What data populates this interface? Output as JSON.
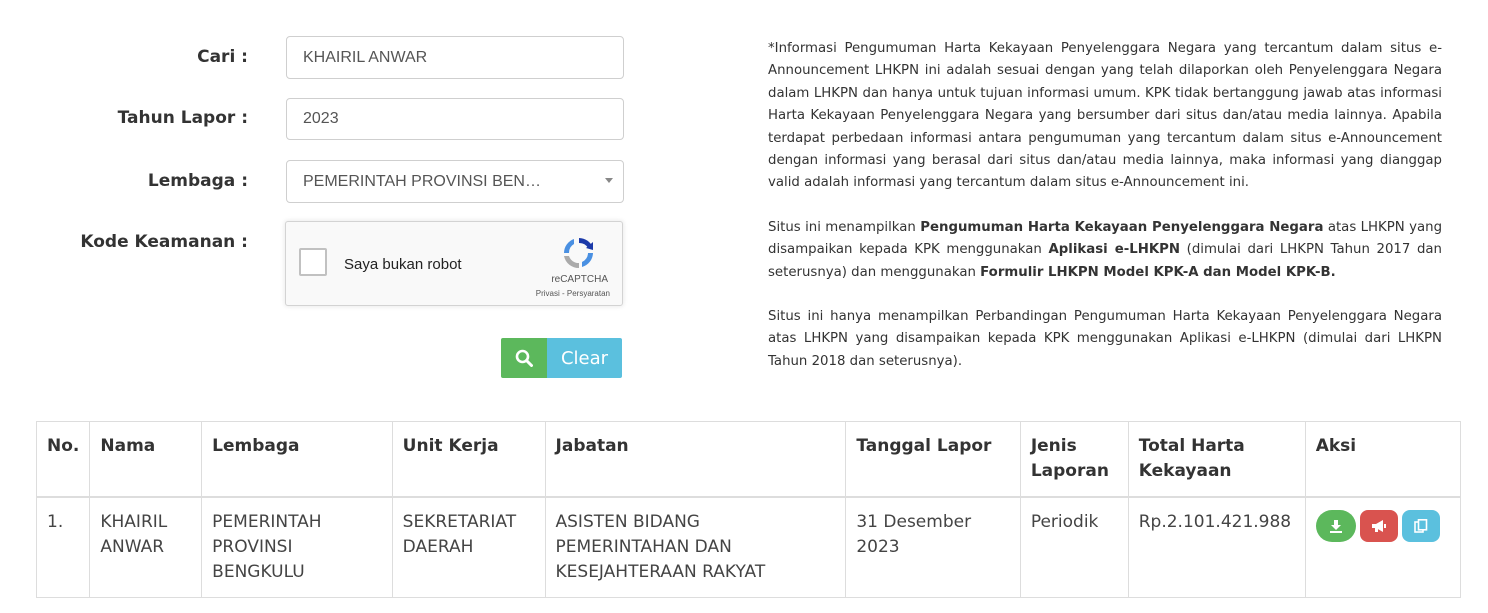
{
  "form": {
    "cari_label": "Cari :",
    "cari_value": "KHAIRIL ANWAR",
    "tahun_label": "Tahun Lapor :",
    "tahun_value": "2023",
    "lembaga_label": "Lembaga :",
    "lembaga_value": "PEMERINTAH PROVINSI BEN…",
    "kode_label": "Kode Keamanan :",
    "captcha_label": "Saya bukan robot",
    "captcha_brand": "reCAPTCHA",
    "captcha_links": "Privasi - Persyaratan",
    "clear_label": "Clear"
  },
  "info": {
    "p1": "*Informasi Pengumuman Harta Kekayaan Penyelenggara Negara yang tercantum dalam situs e-Announcement LHKPN ini adalah sesuai dengan yang telah dilaporkan oleh Penyelenggara Negara dalam LHKPN dan hanya untuk tujuan informasi umum. KPK tidak bertanggung jawab atas informasi Harta Kekayaan Penyelenggara Negara yang bersumber dari situs dan/atau media lainnya. Apabila terdapat perbedaan informasi antara pengumuman yang tercantum dalam situs e-Announcement dengan informasi yang berasal dari situs dan/atau media lainnya, maka informasi yang dianggap valid adalah informasi yang tercantum dalam situs e-Announcement ini.",
    "p2_a": "Situs ini menampilkan ",
    "p2_b": "Pengumuman Harta Kekayaan Penyelenggara Negara",
    "p2_c": " atas LHKPN yang disampaikan kepada KPK menggunakan ",
    "p2_d": "Aplikasi e-LHKPN",
    "p2_e": " (dimulai dari LHKPN Tahun 2017 dan seterusnya) dan menggunakan ",
    "p2_f": "Formulir LHKPN Model KPK-A dan Model KPK-B.",
    "p3": "Situs ini hanya menampilkan Perbandingan Pengumuman Harta Kekayaan Penyelenggara Negara atas LHKPN yang disampaikan kepada KPK menggunakan Aplikasi e-LHKPN (dimulai dari LHKPN Tahun 2018 dan seterusnya)."
  },
  "table": {
    "headers": [
      "No.",
      "Nama",
      "Lembaga",
      "Unit Kerja",
      "Jabatan",
      "Tanggal Lapor",
      "Jenis Laporan",
      "Total Harta Kekayaan",
      "Aksi"
    ],
    "rows": [
      {
        "no": "1.",
        "nama": "KHAIRIL ANWAR",
        "lembaga": "PEMERINTAH PROVINSI BENGKULU",
        "unit_kerja": "SEKRETARIAT DAERAH",
        "jabatan": "ASISTEN BIDANG PEMERINTAHAN DAN KESEJAHTERAAN RAKYAT",
        "tanggal": "31 Desember 2023",
        "jenis": "Periodik",
        "total": "Rp.2.101.421.988"
      }
    ]
  },
  "icons": {
    "search": "search-icon",
    "download": "download-icon",
    "announce": "megaphone-icon",
    "copy": "copy-icon",
    "dropdown": "chevron-down-icon"
  },
  "colors": {
    "green": "#5cb85c",
    "blue": "#5bc0de",
    "red": "#d9534f"
  }
}
